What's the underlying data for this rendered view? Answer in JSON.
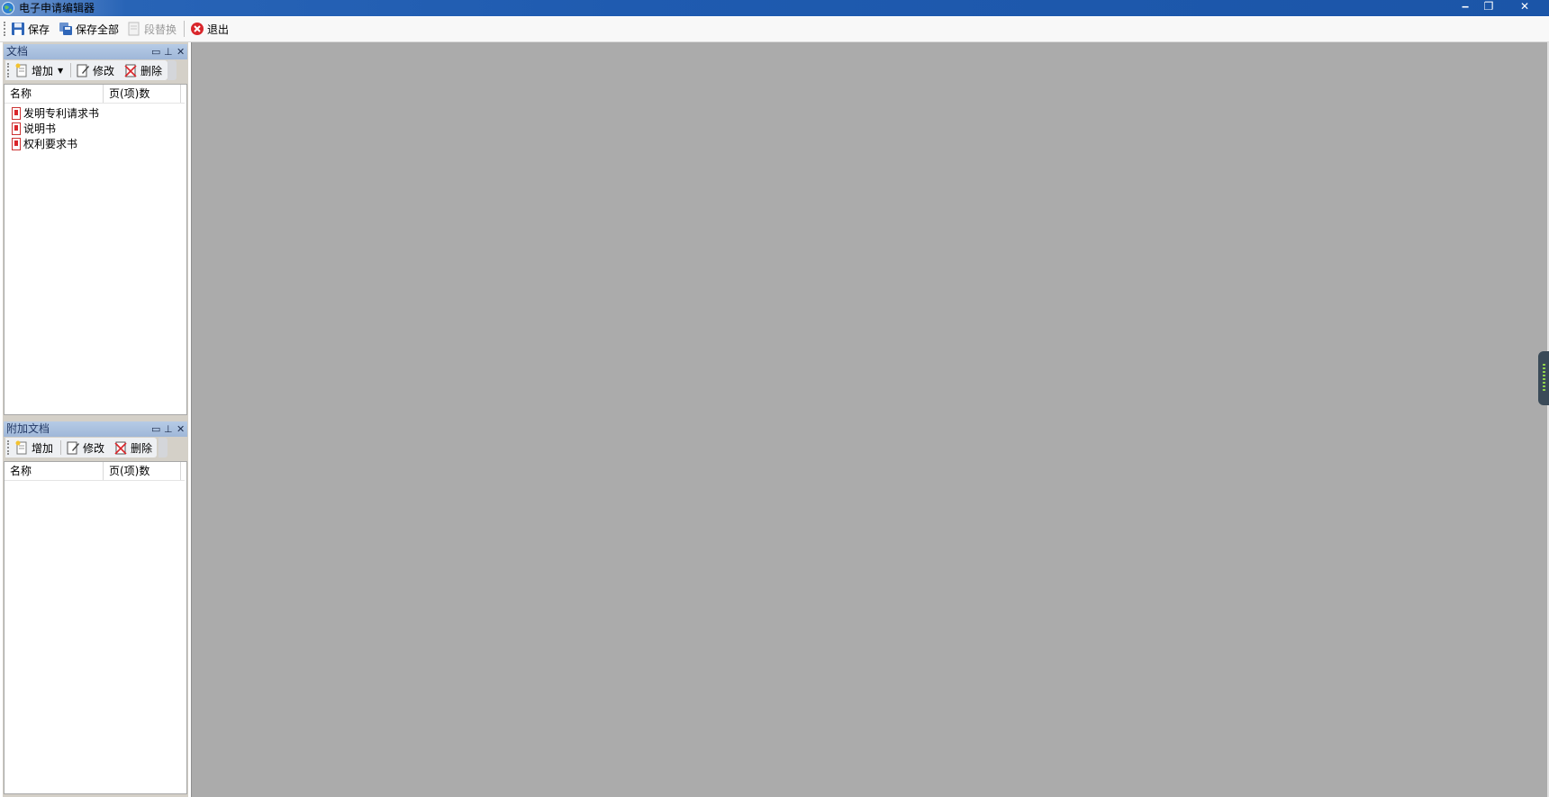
{
  "window": {
    "title": "电子申请编辑器",
    "controls": {
      "minimize": "‒",
      "restore": "❐",
      "close": "✕"
    }
  },
  "toolbar": {
    "save": "保存",
    "save_all": "保存全部",
    "replace": "段替换",
    "exit": "退出"
  },
  "documents_panel": {
    "title": "文档",
    "toolbar": {
      "add": "增加",
      "edit": "修改",
      "delete": "删除"
    },
    "columns": [
      "名称",
      "页(项)数"
    ],
    "items": [
      {
        "name": "发明专利请求书"
      },
      {
        "name": "说明书"
      },
      {
        "name": "权利要求书"
      }
    ]
  },
  "attached_panel": {
    "title": "附加文档",
    "toolbar": {
      "add": "增加",
      "edit": "修改",
      "delete": "删除"
    },
    "columns": [
      "名称",
      "页(项)数"
    ],
    "items": []
  },
  "icons": {
    "app": "globe-icon",
    "save": "floppy-disk-icon",
    "save_all": "multi-floppy-icon",
    "replace": "replace-document-icon",
    "exit": "red-close-circle-icon",
    "add": "new-document-icon",
    "edit": "edit-document-icon",
    "delete": "delete-document-icon",
    "doc_item": "pdf-document-icon"
  },
  "colors": {
    "titlebar": "#1f5bb0",
    "panel_header": "#9fb7d8",
    "workspace": "#ababab",
    "exit_icon": "#d9262b"
  }
}
